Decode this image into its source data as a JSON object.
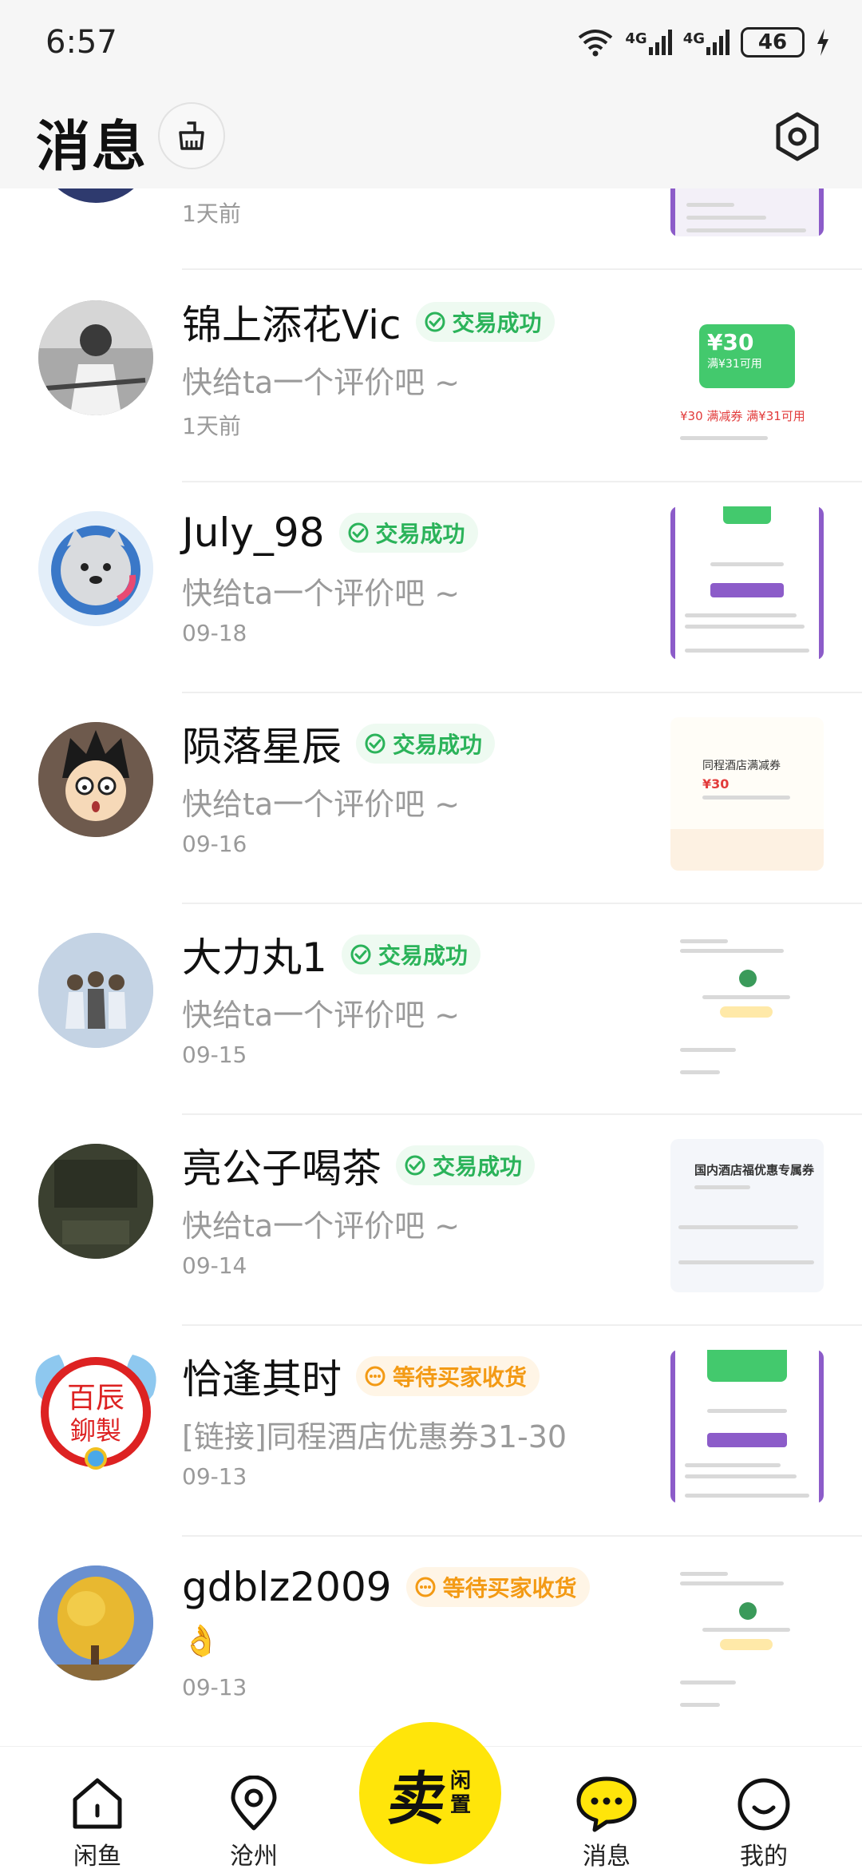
{
  "status_bar": {
    "time": "6:57",
    "network1": "4G",
    "network2": "4G",
    "battery": "46"
  },
  "header": {
    "title": "消息"
  },
  "messages": [
    {
      "name": "",
      "preview": "",
      "time": "1天前",
      "badge": ""
    },
    {
      "name": "锦上添花Vic",
      "badge": "交易成功",
      "badge_type": "ok",
      "preview": "快给ta一个评价吧 ~",
      "time": "1天前",
      "thumb": {
        "price": "¥30",
        "sub": "满¥31可用",
        "caption": "¥30 满减券 满¥31可用"
      }
    },
    {
      "name": "July_98",
      "badge": "交易成功",
      "badge_type": "ok",
      "preview": "快给ta一个评价吧 ~",
      "time": "09-18"
    },
    {
      "name": "陨落星辰",
      "badge": "交易成功",
      "badge_type": "ok",
      "preview": "快给ta一个评价吧 ~",
      "time": "09-16",
      "thumb": {
        "title": "同程酒店满减券",
        "price": "¥30"
      }
    },
    {
      "name": "大力丸1",
      "badge": "交易成功",
      "badge_type": "ok",
      "preview": "快给ta一个评价吧 ~",
      "time": "09-15"
    },
    {
      "name": "亮公子喝茶",
      "badge": "交易成功",
      "badge_type": "ok",
      "preview": "快给ta一个评价吧 ~",
      "time": "09-14",
      "thumb": {
        "title": "国内酒店福优惠专属券"
      }
    },
    {
      "name": "恰逢其时",
      "badge": "等待买家收货",
      "badge_type": "wait",
      "preview": "[链接]同程酒店优惠券31-30",
      "time": "09-13"
    },
    {
      "name": "gdblz2009",
      "badge": "等待买家收货",
      "badge_type": "wait",
      "preview": "👌",
      "time": "09-13"
    }
  ],
  "bottom_nav": {
    "home": "闲鱼",
    "city": "沧州",
    "sell_main": "卖",
    "sell_sub1": "闲",
    "sell_sub2": "置",
    "messages": "消息",
    "me": "我的"
  },
  "colors": {
    "accent_yellow": "#ffe50a",
    "success_green": "#2bb35a",
    "waiting_orange": "#f39a14",
    "thumb_purple": "#8c5cc9"
  }
}
